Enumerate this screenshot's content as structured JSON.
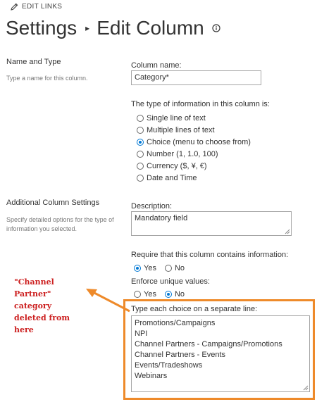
{
  "header": {
    "edit_links_label": "EDIT LINKS",
    "breadcrumb_root": "Settings",
    "breadcrumb_current": "Edit Column"
  },
  "name_and_type": {
    "section_title": "Name and Type",
    "section_desc": "Type a name for this column.",
    "column_name_label": "Column name:",
    "column_name_value": "Category*",
    "type_label": "The type of information in this column is:",
    "type_options": [
      {
        "label": "Single line of text",
        "selected": false
      },
      {
        "label": "Multiple lines of text",
        "selected": false
      },
      {
        "label": "Choice (menu to choose from)",
        "selected": true
      },
      {
        "label": "Number (1, 1.0, 100)",
        "selected": false
      },
      {
        "label": "Currency ($, ¥, €)",
        "selected": false
      },
      {
        "label": "Date and Time",
        "selected": false
      }
    ]
  },
  "additional_settings": {
    "section_title": "Additional Column Settings",
    "section_desc_line1": "Specify detailed options for the type of",
    "section_desc_line2": "information you selected.",
    "description_label": "Description:",
    "description_value": "Mandatory field",
    "require_label": "Require that this column contains information:",
    "require_yes": "Yes",
    "require_no": "No",
    "require_selected": "Yes",
    "unique_label": "Enforce unique values:",
    "unique_yes": "Yes",
    "unique_no": "No",
    "unique_selected": "No",
    "choices_label": "Type each choice on a separate line:",
    "choices": [
      "Promotions/Campaigns",
      "NPI",
      "Channel Partners - Campaigns/Promotions",
      "Channel Partners - Events",
      "Events/Tradeshows",
      "Webinars"
    ]
  },
  "annotation": {
    "lines": [
      "\"Channel",
      "Partner\"",
      "category",
      "deleted from",
      "here"
    ],
    "text_color": "#cc1f1f",
    "highlight_color": "#ee8a2a"
  },
  "colors": {
    "accent": "#0078d4",
    "border": "#a6a6a6"
  }
}
